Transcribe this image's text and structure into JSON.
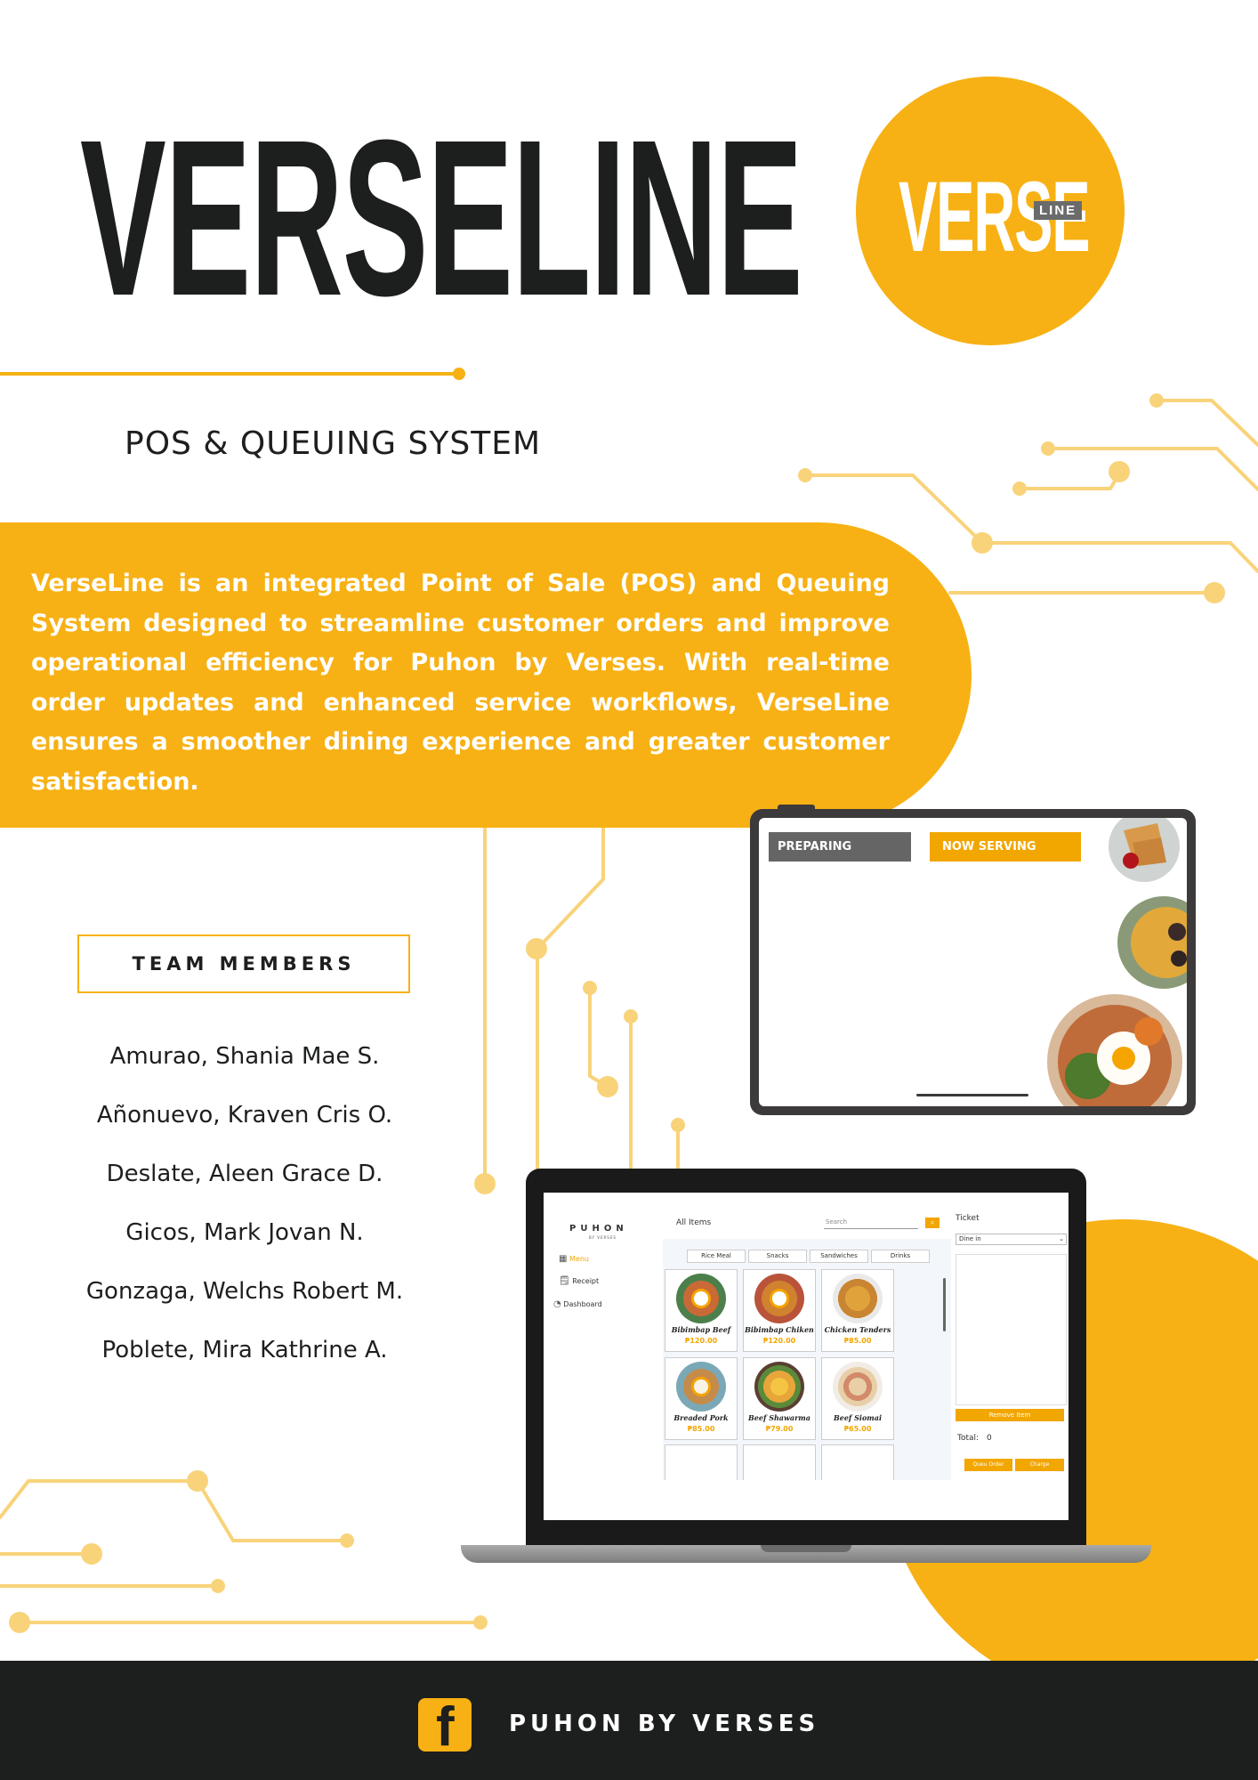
{
  "header": {
    "title": "VERSELINE",
    "subtitle": "POS & QUEUING SYSTEM"
  },
  "logo": {
    "word": "VERSE",
    "tag": "LINE"
  },
  "description": "VerseLine is an integrated Point of Sale (POS) and Queuing System designed to streamline customer orders and improve operational efficiency for Puhon by Verses. With real-time order updates and enhanced service workflows, VerseLine ensures a smoother dining experience and greater customer satisfaction.",
  "team": {
    "title": "TEAM MEMBERS",
    "members": [
      "Amurao, Shania Mae S.",
      "Añonuevo, Kraven Cris O.",
      "Deslate, Aleen Grace D.",
      "Gicos, Mark Jovan N.",
      "Gonzaga, Welchs Robert M.",
      "Poblete, Mira Kathrine A."
    ]
  },
  "queue_display": {
    "preparing_label": "PREPARING",
    "serving_label": "NOW SERVING"
  },
  "pos_app": {
    "brand": "PUHON",
    "brand_sub": "BY VERSES",
    "sidebar": [
      {
        "label": "Menu",
        "icon": "menu-grid-icon",
        "active": true
      },
      {
        "label": "Receipt",
        "icon": "receipt-icon",
        "active": false
      },
      {
        "label": "Dashboard",
        "icon": "dashboard-gauge-icon",
        "active": false
      }
    ],
    "section_title": "All Items",
    "search_placeholder": "Search",
    "categories": [
      "Rice Meal",
      "Snacks",
      "Sandwiches",
      "Drinks"
    ],
    "items": [
      {
        "name": "Bibimbap Beef",
        "price": "₱120.00"
      },
      {
        "name": "Bibimbap Chiken",
        "price": "₱120.00"
      },
      {
        "name": "Chicken Tenders",
        "price": "₱85.00"
      },
      {
        "name": "Breaded Pork",
        "price": "₱85.00"
      },
      {
        "name": "Beef  Shawarma",
        "price": "₱79.00"
      },
      {
        "name": "Beef Siomai",
        "price": "₱65.00"
      }
    ],
    "ticket": {
      "title": "Ticket",
      "order_type": "Dine in",
      "remove_label": "Remove Item",
      "total_label": "Total:",
      "total_value": "0",
      "queue_label": "Queu Order",
      "charge_label": "Charge"
    }
  },
  "footer": {
    "name": "PUHON BY VERSES",
    "icon": "facebook-icon"
  },
  "colors": {
    "accent": "#f7b114",
    "dark": "#1d1f1e",
    "circuit": "#f9d37a"
  }
}
